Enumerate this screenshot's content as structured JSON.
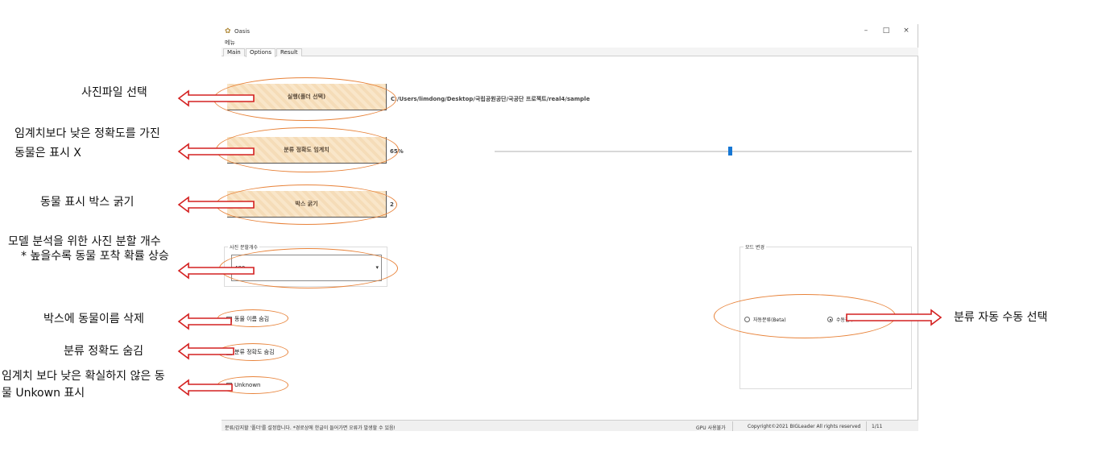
{
  "window": {
    "title": "Oasis",
    "menu": "메뉴",
    "controls": {
      "minimize": "–",
      "maximize": "□",
      "close": "×"
    },
    "tabs": [
      {
        "label": "Main"
      },
      {
        "label": "Options",
        "active": true
      },
      {
        "label": "Result"
      }
    ]
  },
  "options": {
    "folder_button": "실행(폴더 선택)",
    "folder_path": "C:/Users/limdong/Desktop/국립공원공단/국공단 프로젝트/real4/sample",
    "threshold_button": "분류 정확도 임계치",
    "threshold_value": "65%",
    "threshold_slider_fraction": 0.56,
    "box_button": "박스 굵기",
    "box_value": "2",
    "split_group_label": "사진 분할개수",
    "split_value": "480",
    "hide_name_label": "동물 이름 숨김",
    "hide_name_checked": false,
    "hide_accuracy_label": "분류 정확도 숨김",
    "hide_accuracy_checked": true,
    "unknown_label": "Unknown",
    "unknown_checked": false,
    "mode_group_label": "모드 변경",
    "mode_auto_label": "자동분류(Beta)",
    "mode_manual_label": "수동검수",
    "mode_selected": "manual"
  },
  "statusbar": {
    "message": "분류/감지할 '폴더'를 설정합니다. *경로상에 한글이 들어가면 오류가 발생할 수 있음!",
    "gpu": "GPU 사용불가",
    "copyright": "Copyright©2021 BIGLeader All rights reserved",
    "page": "1/11"
  },
  "annotations": {
    "folder": "사진파일 선택",
    "threshold": [
      "임계치보다 낮은 정확도를 가진",
      "동물은 표시 X"
    ],
    "box": "동물 표시 박스 굵기",
    "split": [
      "모델 분석을 위한 사진 분할 개수",
      "* 높을수록 동물 포착 확률 상승"
    ],
    "hide_name": "박스에 동물이름 삭제",
    "hide_accuracy": "분류 정확도 숨김",
    "unknown": [
      "임계치 보다 낮은 확실하지 않은 동",
      "물 Unkown 표시"
    ],
    "mode": "분류 자동 수동 선택"
  },
  "colors": {
    "accent_orange": "#e8833a",
    "arrow_red": "#d42020",
    "slider_blue": "#1677d4",
    "button_fill": "#f5dcb8"
  }
}
